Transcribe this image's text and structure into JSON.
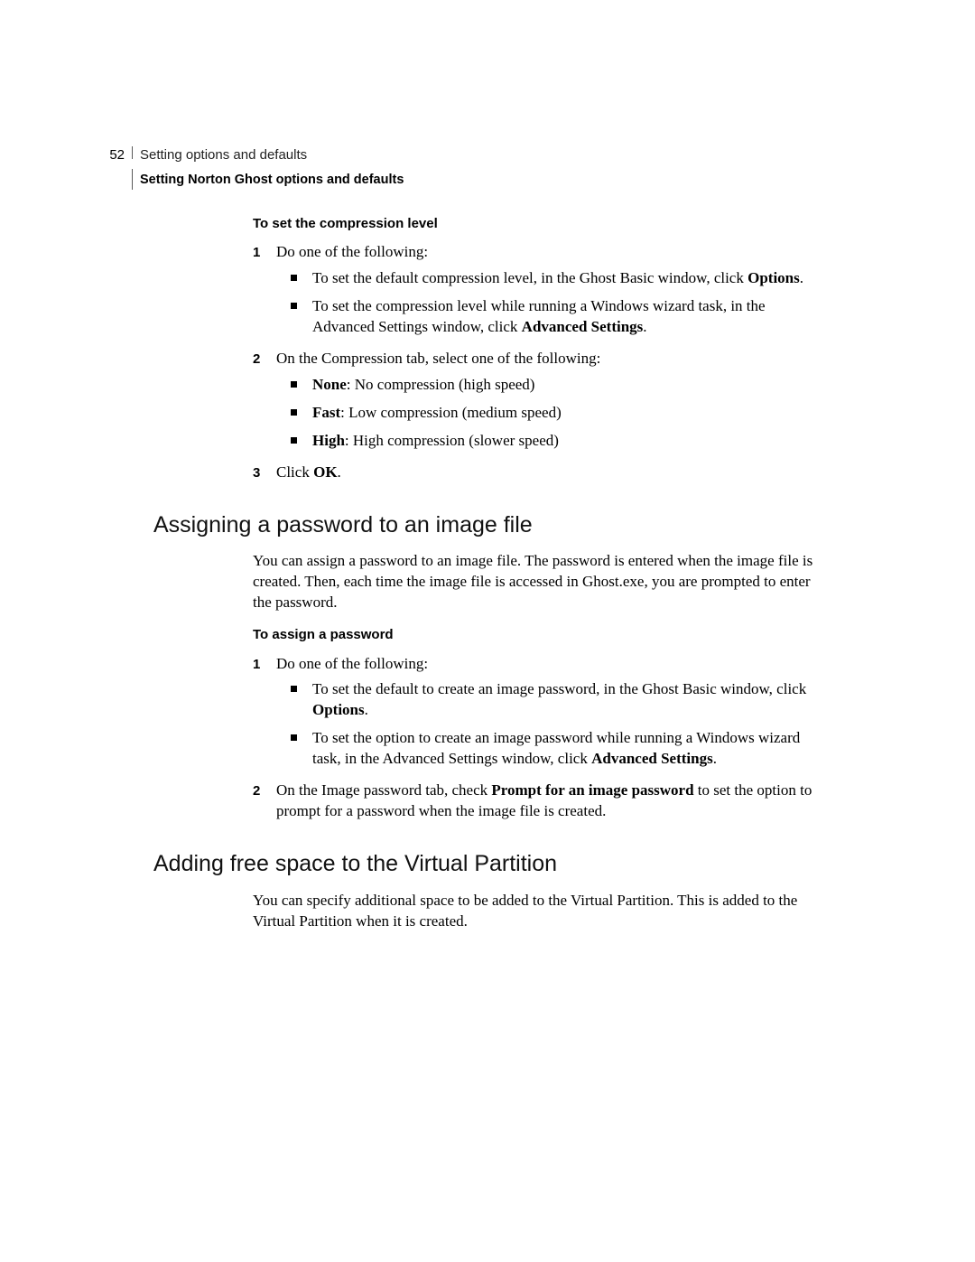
{
  "header": {
    "page_number": "52",
    "chapter_title": "Setting options and defaults",
    "section_title": "Setting Norton Ghost options and defaults"
  },
  "proc1": {
    "title": "To set the compression level",
    "step1_num": "1",
    "step1_lead": "Do one of the following:",
    "step1_b1a": "To set the default compression level, in the Ghost Basic window, click ",
    "step1_b1_bold": "Options",
    "step1_b1b": ".",
    "step1_b2a": "To set the compression level while running a Windows wizard task, in the Advanced Settings window, click ",
    "step1_b2_bold": "Advanced Settings",
    "step1_b2b": ".",
    "step2_num": "2",
    "step2_lead": "On the Compression tab, select one of the following:",
    "step2_b1_bold": "None",
    "step2_b1_rest": ": No compression (high speed)",
    "step2_b2_bold": "Fast",
    "step2_b2_rest": ": Low compression (medium speed)",
    "step2_b3_bold": "High",
    "step2_b3_rest": ": High compression (slower speed)",
    "step3_num": "3",
    "step3a": "Click ",
    "step3_bold": "OK",
    "step3b": "."
  },
  "h2_password": "Assigning a password to an image file",
  "para_password": "You can assign a password to an image file. The password is entered when the image file is created. Then, each time the image file is accessed in Ghost.exe, you are prompted to enter the password.",
  "proc2": {
    "title": "To assign a password",
    "step1_num": "1",
    "step1_lead": "Do one of the following:",
    "step1_b1a": "To set the default to create an image password, in the Ghost Basic window, click ",
    "step1_b1_bold": "Options",
    "step1_b1b": ".",
    "step1_b2a": "To set the option to create an image password while running a Windows wizard task, in the Advanced Settings window, click ",
    "step1_b2_bold": "Advanced Settings",
    "step1_b2b": ".",
    "step2_num": "2",
    "step2a": "On the Image password tab, check ",
    "step2_bold": "Prompt for an image password",
    "step2b": " to set the option to prompt for a password when the image file is created."
  },
  "h2_freespace": "Adding free space to the Virtual Partition",
  "para_freespace": "You can specify additional space to be added to the Virtual Partition. This is added to the Virtual Partition when it is created."
}
